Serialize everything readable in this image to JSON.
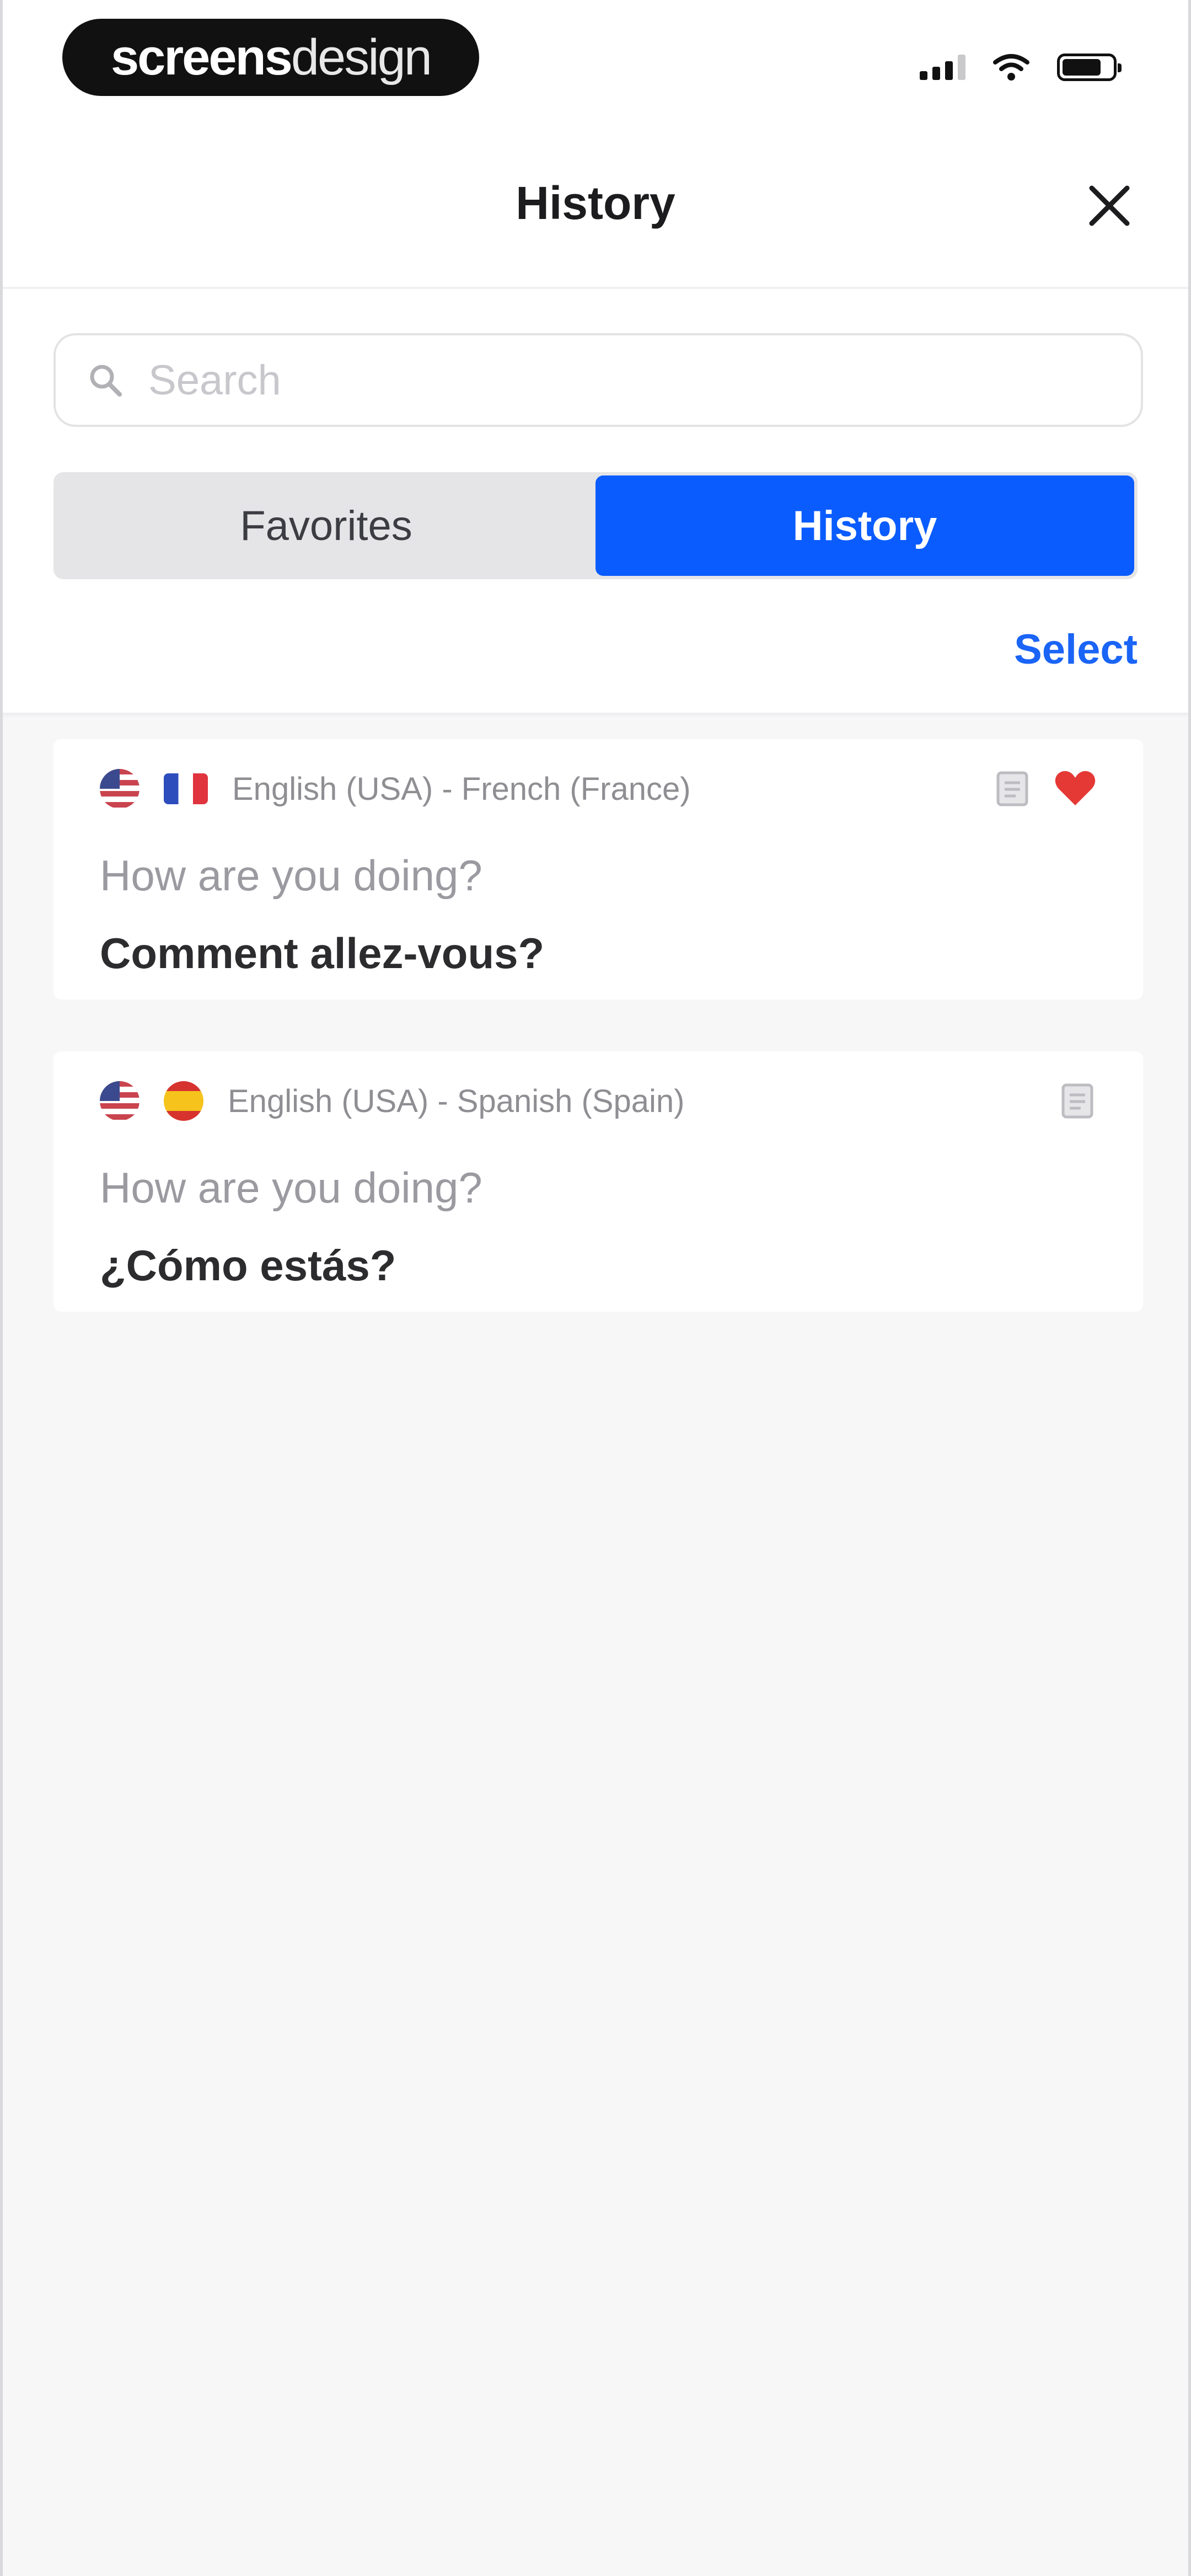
{
  "status_bar": {
    "watermark_bold": "screens",
    "watermark_light": "design"
  },
  "nav": {
    "title": "History",
    "close_icon": "close-icon"
  },
  "search": {
    "placeholder": "Search",
    "value": "",
    "icon": "search-icon"
  },
  "tabs": [
    {
      "label": "Favorites",
      "active": false
    },
    {
      "label": "History",
      "active": true
    }
  ],
  "select_label": "Select",
  "colors": {
    "accent": "#0a5cff",
    "link": "#1a64f6",
    "favorite": "#e53935"
  },
  "history": [
    {
      "source_flag": "us-flag-icon",
      "target_flag": "france-flag-icon",
      "pair": "English (USA) - French (France)",
      "source": "How are you doing?",
      "translation": "Comment allez-vous?",
      "favorite": true
    },
    {
      "source_flag": "us-flag-icon",
      "target_flag": "spain-flag-icon",
      "pair": "English (USA) - Spanish (Spain)",
      "source": "How are you doing?",
      "translation": "¿Cómo estás?",
      "favorite": false
    }
  ]
}
